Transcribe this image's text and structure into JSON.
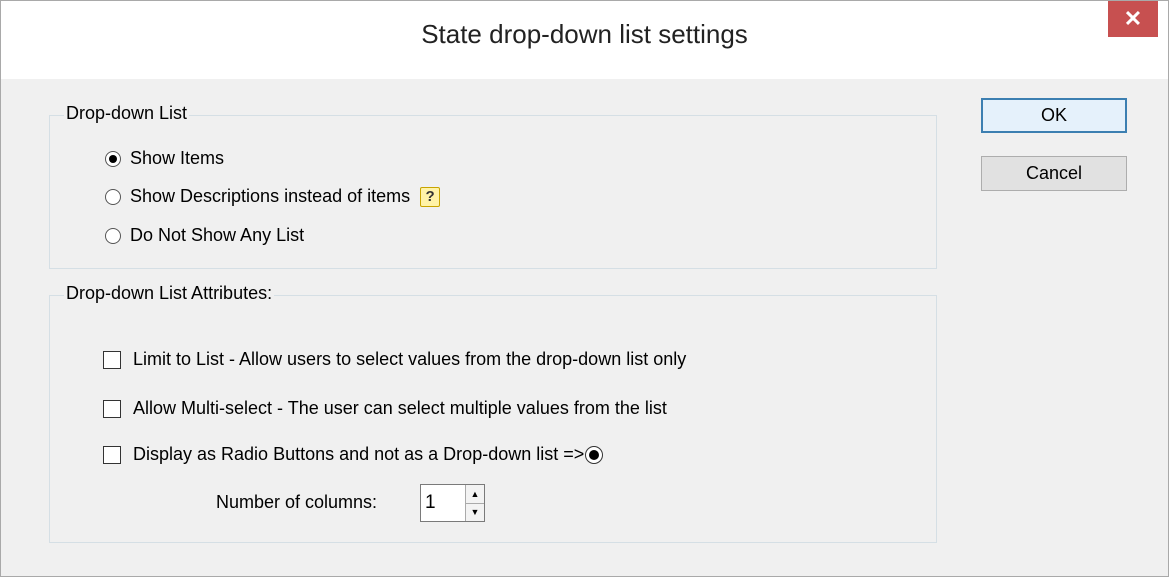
{
  "window": {
    "title": "State drop-down list settings",
    "close_label": "✕"
  },
  "dropdown_list": {
    "group_label": "Drop-down List",
    "options": [
      {
        "label": "Show Items",
        "selected": true
      },
      {
        "label": "Show Descriptions instead of items",
        "selected": false
      },
      {
        "label": "Do Not Show Any List",
        "selected": false
      }
    ],
    "help_icon": "?"
  },
  "attributes": {
    "group_label": "Drop-down List Attributes:",
    "checkboxes": [
      {
        "label": "Limit to List - Allow users to select values from the drop-down list only",
        "checked": false
      },
      {
        "label": "Allow Multi-select - The user can select multiple values from the list",
        "checked": false
      },
      {
        "label": "Display as Radio Buttons and not as a Drop-down list =>",
        "checked": false
      }
    ],
    "columns_label": "Number of columns:",
    "columns_value": "1"
  },
  "buttons": {
    "ok": "OK",
    "cancel": "Cancel"
  }
}
